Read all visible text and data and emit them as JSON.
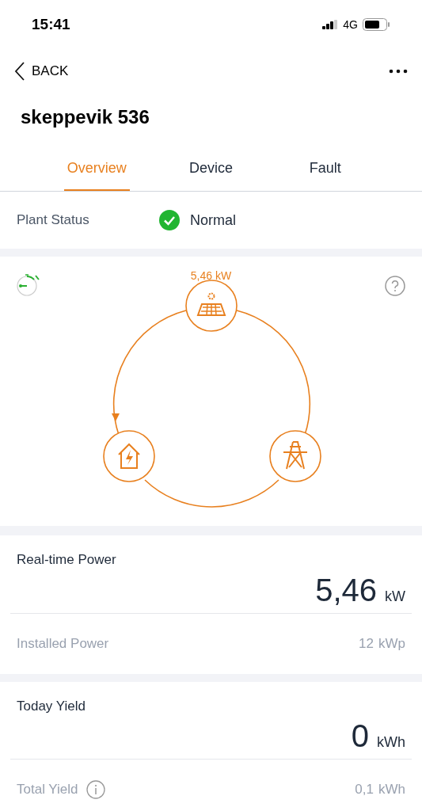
{
  "status_bar": {
    "time": "15:41",
    "network": "4G"
  },
  "nav": {
    "back": "BACK"
  },
  "title": "skeppevik 536",
  "tabs": [
    {
      "label": "Overview",
      "selected": true
    },
    {
      "label": "Device",
      "selected": false
    },
    {
      "label": "Fault",
      "selected": false
    }
  ],
  "plant_status": {
    "label": "Plant Status",
    "value": "Normal",
    "normal": true
  },
  "flow": {
    "solar_power": "5,46 kW"
  },
  "cards": [
    {
      "title": "Real-time Power",
      "value": "5,46",
      "unit": "kW",
      "sub_label": "Installed Power",
      "sub_value": "12",
      "sub_unit": "kWp",
      "info": false
    },
    {
      "title": "Today Yield",
      "value": "0",
      "unit": "kWh",
      "sub_label": "Total Yield",
      "sub_value": "0,1",
      "sub_unit": "kWh",
      "info": true
    }
  ]
}
